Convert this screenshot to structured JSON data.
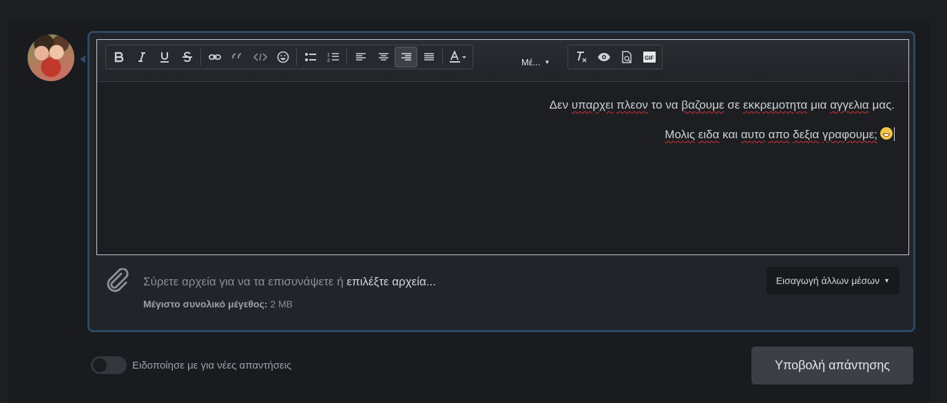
{
  "editor": {
    "toolbar": {
      "media_label": "Μέ...",
      "buttons": [
        "bold-icon",
        "italic-icon",
        "underline-icon",
        "strikethrough-icon",
        "link-icon",
        "quote-icon",
        "code-icon",
        "smiley-icon",
        "bullet-list-icon",
        "numbered-list-icon",
        "align-left-icon",
        "align-center-icon",
        "align-right-icon",
        "justify-icon",
        "text-color-icon",
        "remove-format-icon",
        "preview-icon",
        "drafts-icon",
        "gif-icon"
      ],
      "active_button": "align-right-icon"
    },
    "content": {
      "line1": {
        "w1": "Δεν",
        "w2": "υπαρχει",
        "w3": "πλεον",
        "w4": "το",
        "w5": "να",
        "w6": "βαζουμε",
        "w7": "σε",
        "w8": "εκκρεμοτητα",
        "w9": "μια",
        "w10": "αγγελια",
        "w11": "μας."
      },
      "line2": {
        "w1": "Μολις",
        "w2": "ειδα",
        "w3": "και",
        "w4": "αυτο",
        "w5": "απο",
        "w6": "δεξια",
        "w7": "γραφουμε;"
      },
      "emoji": "grinning-with-sweat-emoji"
    }
  },
  "attachments": {
    "drag_text": "Σύρετε αρχεία για να τα επισυνάψετε ή",
    "choose_link": "επιλέξτε αρχεία...",
    "max_size_label": "Μέγιστο συνολικό μέγεθος:",
    "max_size_value": "2 MB",
    "insert_media_label": "Εισαγωγή άλλων μέσων"
  },
  "notify": {
    "label": "Ειδοποίησε με για νέες απαντήσεις",
    "enabled": false
  },
  "submit_label": "Υποβολή απάντησης",
  "colors": {
    "frame_border": "#2b4a66",
    "background": "#1c1e21",
    "button": "#3c4046"
  }
}
